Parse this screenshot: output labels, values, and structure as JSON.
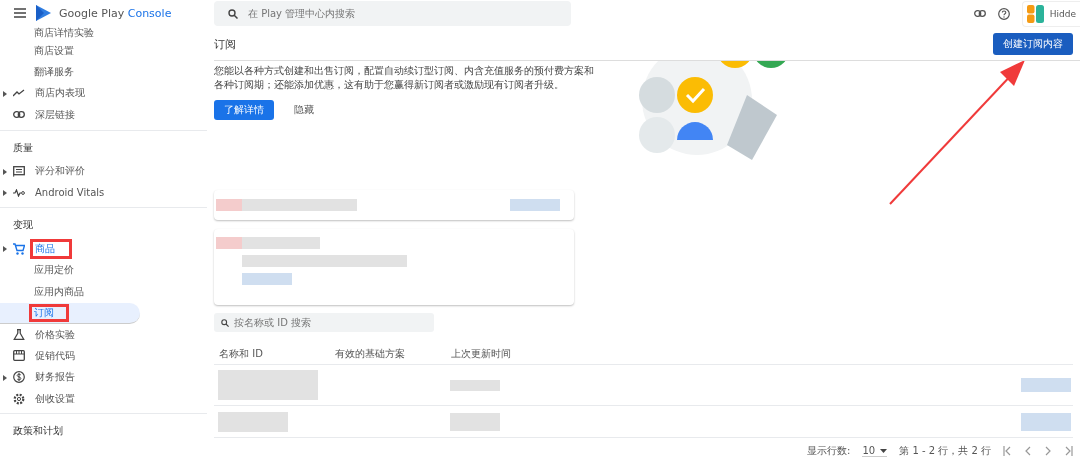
{
  "app": {
    "logo_text": "Google Play",
    "logo_accent": "Console",
    "account": "Hidde"
  },
  "search": {
    "placeholder": "在 Play 管理中心内搜索"
  },
  "sidebar": {
    "sections": [
      {
        "items": [
          {
            "label": "商店详情实验",
            "kind": "sub",
            "expandable": false,
            "selected": false,
            "active": false,
            "annotated": false
          },
          {
            "label": "商店设置",
            "kind": "sub",
            "expandable": false,
            "selected": false,
            "active": false,
            "annotated": false
          },
          {
            "label": "翻译服务",
            "kind": "sub",
            "expandable": false,
            "selected": false,
            "active": false,
            "annotated": false
          },
          {
            "label": "商店内表现",
            "kind": "trend",
            "expandable": true,
            "selected": false,
            "active": false,
            "annotated": false
          },
          {
            "label": "深层链接",
            "kind": "link",
            "expandable": false,
            "selected": false,
            "active": false,
            "annotated": false
          }
        ]
      },
      {
        "heading": "质量",
        "items": [
          {
            "label": "评分和评价",
            "kind": "review",
            "expandable": true,
            "selected": false,
            "active": false,
            "annotated": false
          },
          {
            "label": "Android Vitals",
            "kind": "vitals",
            "expandable": true,
            "selected": false,
            "active": false,
            "annotated": false
          }
        ]
      },
      {
        "heading": "变现",
        "items": [
          {
            "label": "商品",
            "kind": "cart",
            "expandable": true,
            "selected": false,
            "active": true,
            "annotated": true
          },
          {
            "label": "应用定价",
            "kind": "sub",
            "expandable": false,
            "selected": false,
            "active": false,
            "annotated": false
          },
          {
            "label": "应用内商品",
            "kind": "sub",
            "expandable": false,
            "selected": false,
            "active": false,
            "annotated": false
          },
          {
            "label": "订阅",
            "kind": "sub",
            "expandable": false,
            "selected": true,
            "active": false,
            "annotated": true
          },
          {
            "label": "价格实验",
            "kind": "flask",
            "expandable": false,
            "selected": false,
            "active": false,
            "annotated": false
          },
          {
            "label": "促销代码",
            "kind": "store",
            "expandable": false,
            "selected": false,
            "active": false,
            "annotated": false
          },
          {
            "label": "财务报告",
            "kind": "dollar",
            "expandable": true,
            "selected": false,
            "active": false,
            "annotated": false
          },
          {
            "label": "创收设置",
            "kind": "gear",
            "expandable": false,
            "selected": false,
            "active": false,
            "annotated": false
          }
        ]
      },
      {
        "heading": "政策和计划"
      }
    ]
  },
  "page": {
    "title": "订阅",
    "primary_button": "创建订阅内容"
  },
  "banner": {
    "text_lines": [
      "您能以各种方式创建和出售订阅，配置自动续订型订阅、内含充值服务的预付费方案和",
      "各种订阅期；还能添加优惠，这有助于您赢得新订阅者或激励现有订阅者升级。"
    ],
    "learn_more": "了解详情",
    "hide": "隐藏"
  },
  "cards": [
    {
      "kind": "single"
    },
    {
      "kind": "double"
    }
  ],
  "table": {
    "search_placeholder": "按名称或 ID 搜索",
    "columns": [
      "名称和 ID",
      "有效的基础方案",
      "上次更新时间"
    ],
    "rows": [
      {
        "kind": "tall"
      },
      {
        "kind": "short"
      }
    ]
  },
  "pagination": {
    "rows_label": "显示行数:",
    "rows_value": "10",
    "range": "第 1 - 2 行，共 2 行"
  },
  "annotation_arrow": true
}
